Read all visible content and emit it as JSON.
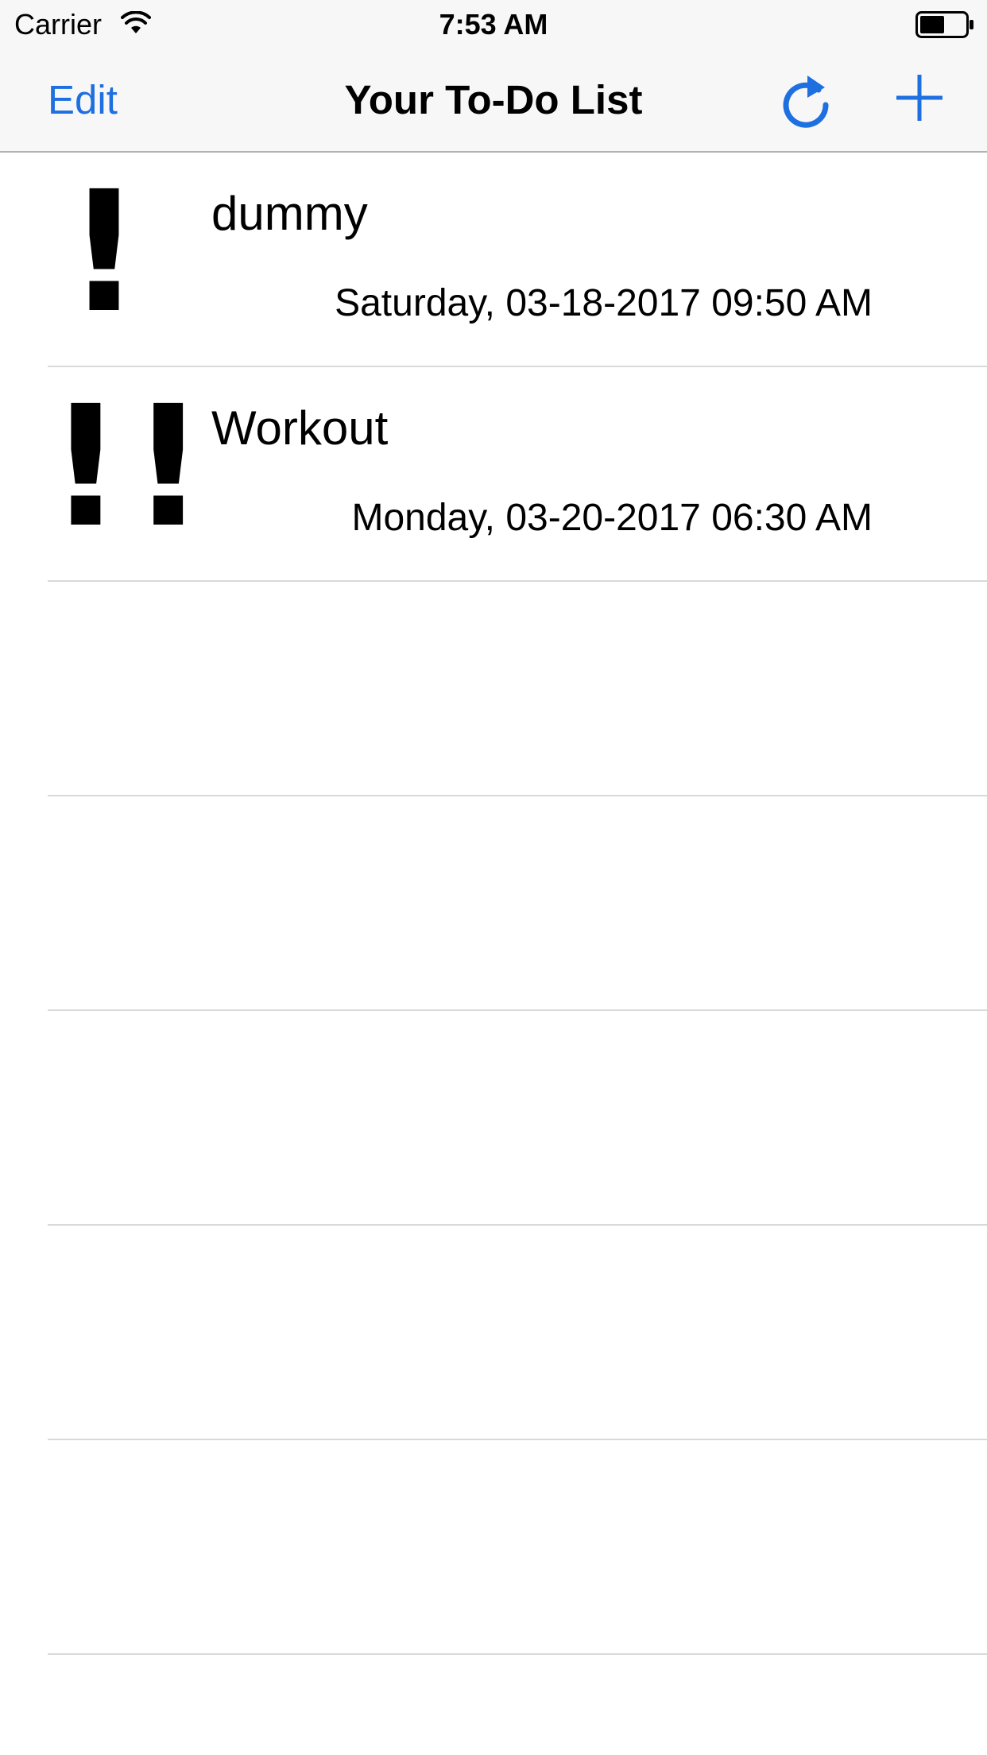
{
  "status_bar": {
    "carrier": "Carrier",
    "time": "7:53 AM",
    "wifi_icon": "wifi-icon",
    "battery_icon": "battery-icon"
  },
  "nav": {
    "edit_label": "Edit",
    "title": "Your To-Do List",
    "refresh_icon": "refresh-icon",
    "add_icon": "plus-icon",
    "tint_color": "#1e6fe0"
  },
  "todos": [
    {
      "priority": "!",
      "title": "dummy",
      "date": "Saturday, 03-18-2017 09:50 AM"
    },
    {
      "priority": "!!",
      "title": "Workout",
      "date": "Monday, 03-20-2017 06:30 AM"
    }
  ],
  "empty_rows": 5
}
